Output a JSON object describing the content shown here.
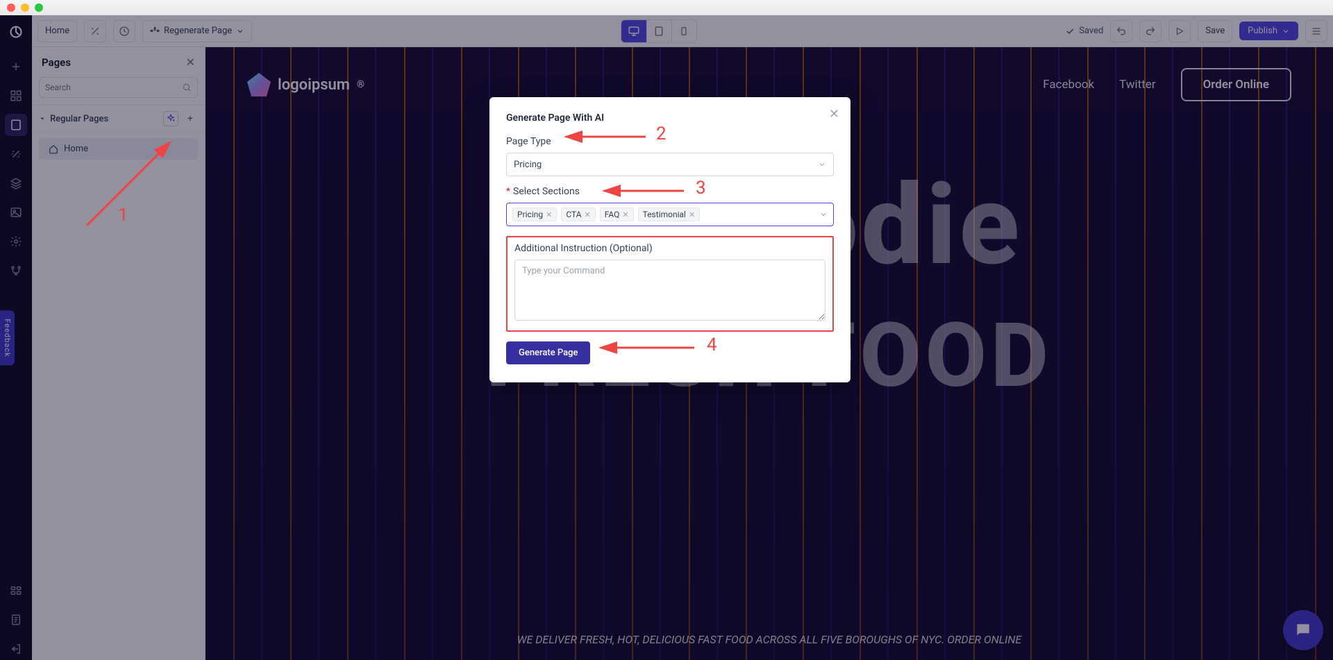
{
  "topbar": {
    "page_name": "Home",
    "regenerate": "Regenerate Page",
    "saved": "Saved",
    "save": "Save",
    "publish": "Publish"
  },
  "panel": {
    "title": "Pages",
    "search_placeholder": "Search",
    "section": "Regular Pages",
    "items": [
      {
        "label": "Home"
      }
    ]
  },
  "site": {
    "logo_text": "logoipsum",
    "nav": [
      "Facebook",
      "Twitter"
    ],
    "order_btn": "Order Online",
    "hero_line1": "NYFoodie",
    "hero_line2": "FRESH FOOD",
    "tagline": "WE DELIVER FRESH, HOT, DELICIOUS FAST FOOD ACROSS ALL FIVE BOROUGHS OF NYC. ORDER ONLINE"
  },
  "modal": {
    "title": "Generate Page With AI",
    "page_type_label": "Page Type",
    "page_type_value": "Pricing",
    "sections_label": "Select Sections",
    "section_tags": [
      "Pricing",
      "CTA",
      "FAQ",
      "Testimonial"
    ],
    "additional_label": "Additional Instruction (Optional)",
    "textarea_placeholder": "Type your Command",
    "submit": "Generate Page"
  },
  "annotations": {
    "n1": "1",
    "n2": "2",
    "n3": "3",
    "n4": "4"
  },
  "feedback": "Feedback"
}
